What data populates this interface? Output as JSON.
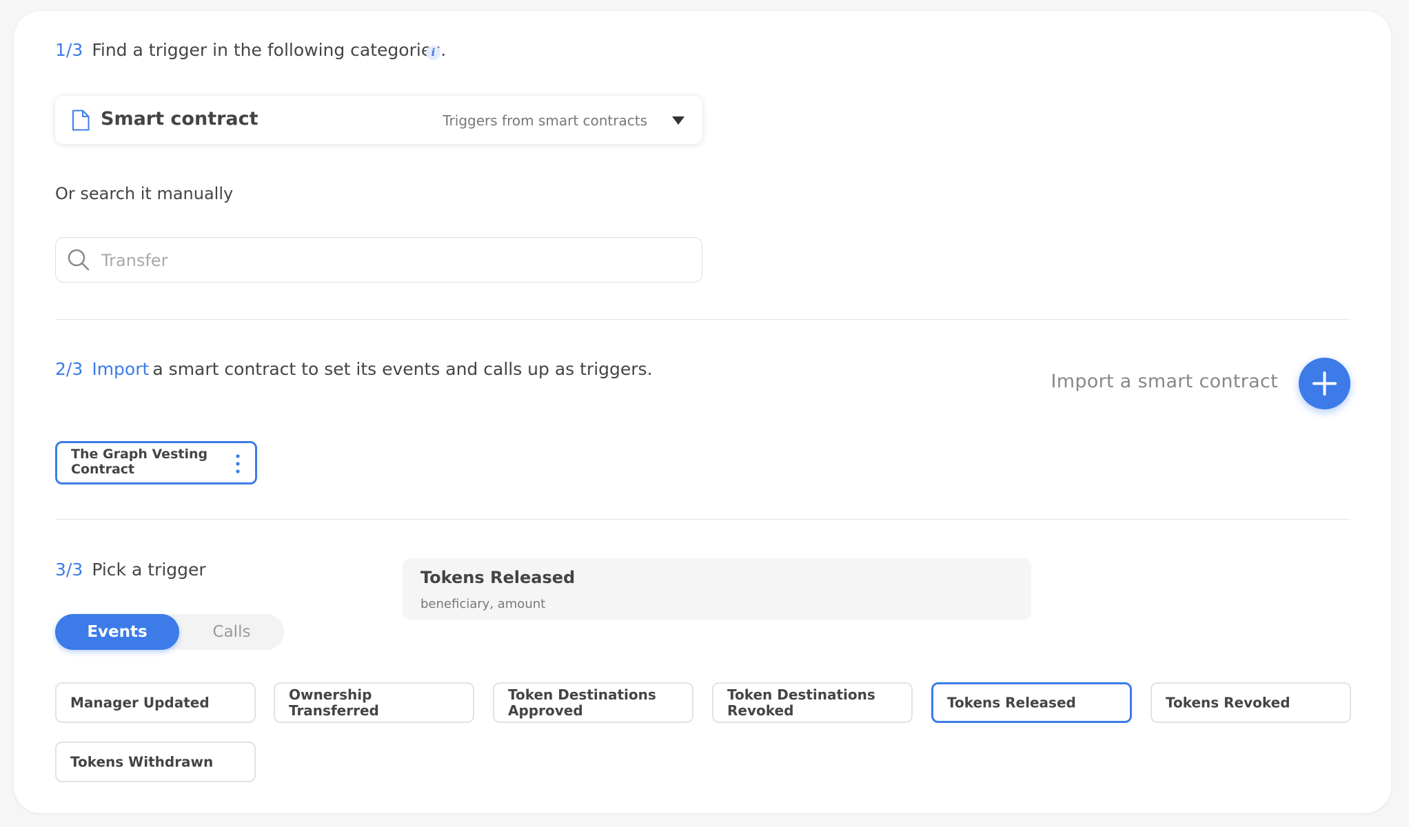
{
  "step1": {
    "number": "1/3",
    "text": "Find a trigger in the following categories.",
    "info_icon_glyph": "i",
    "category": {
      "icon": "document-icon",
      "title": "Smart contract",
      "subtitle": "Triggers from smart contracts"
    },
    "search_label": "Or search it manually",
    "search_placeholder": "Transfer"
  },
  "step2": {
    "number": "2/3",
    "link_text": "Import",
    "text": "a smart contract to set its events and calls up as triggers.",
    "import_button_label": "Import a smart contract",
    "contract_name": "The Graph Vesting Contract"
  },
  "step3": {
    "number": "3/3",
    "text": "Pick a trigger",
    "tabs": [
      {
        "label": "Events",
        "active": true
      },
      {
        "label": "Calls",
        "active": false
      }
    ],
    "preview": {
      "title": "Tokens Released",
      "params": "beneficiary, amount"
    },
    "triggers": [
      {
        "label": "Manager Updated",
        "selected": false
      },
      {
        "label": "Ownership Transferred",
        "selected": false
      },
      {
        "label": "Token Destinations Approved",
        "selected": false
      },
      {
        "label": "Token Destinations Revoked",
        "selected": false
      },
      {
        "label": "Tokens Released",
        "selected": true
      },
      {
        "label": "Tokens Revoked",
        "selected": false
      },
      {
        "label": "Tokens Withdrawn",
        "selected": false
      }
    ]
  },
  "colors": {
    "accent": "#3c7be8",
    "text": "#444444",
    "muted": "#888888",
    "border": "#e2e2e2",
    "background": "#f6f6f6",
    "card": "#ffffff"
  }
}
